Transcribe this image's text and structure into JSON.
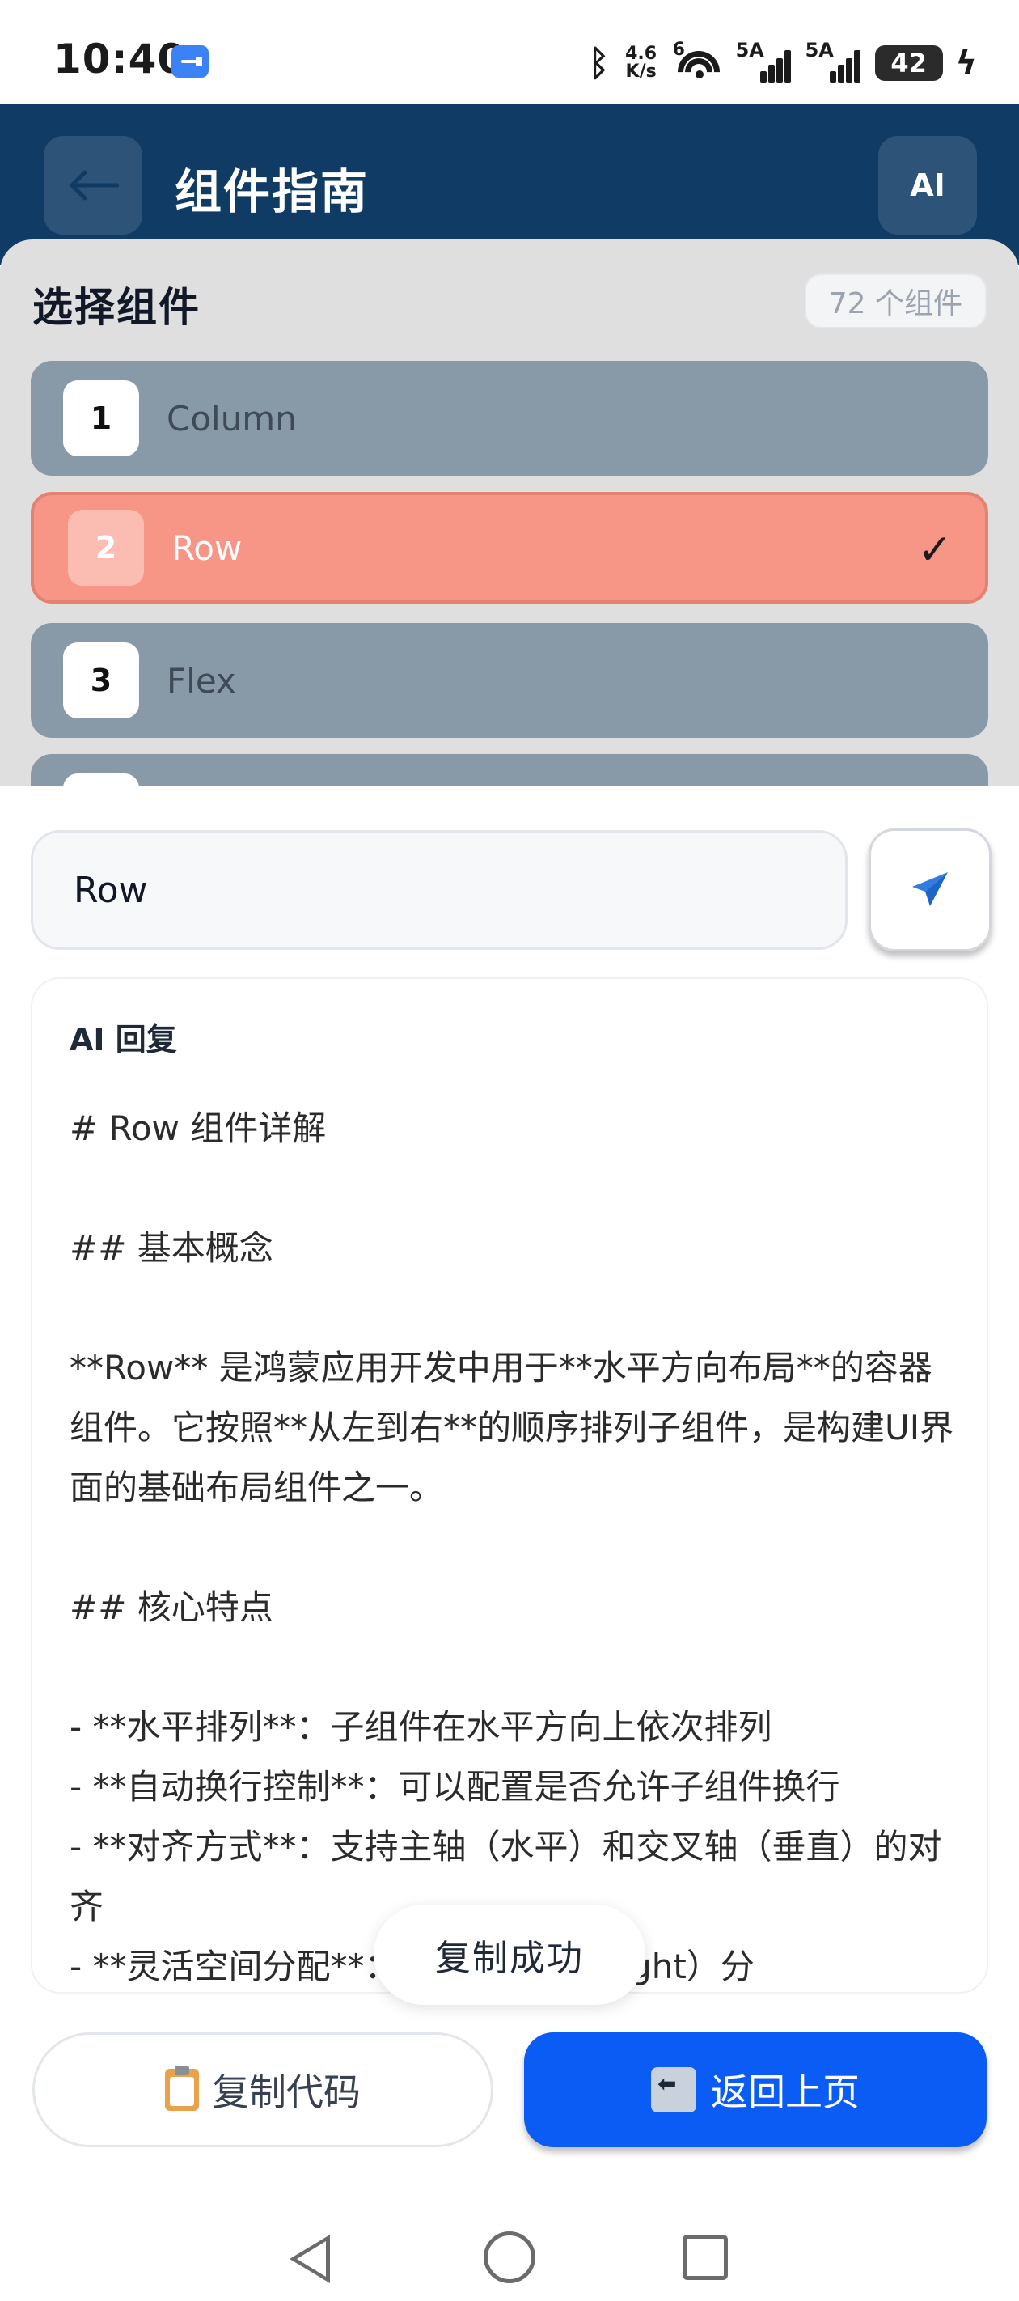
{
  "status_bar": {
    "time": "10:40",
    "network_speed": "4.6\nK/s",
    "wifi_tag": "6",
    "signal1_tag": "5A",
    "signal2_tag": "5A",
    "battery": "42"
  },
  "header": {
    "title": "组件指南",
    "ai_label": "AI"
  },
  "selector": {
    "title": "选择组件",
    "count": "72 个组件",
    "items": [
      {
        "num": "1",
        "name": "Column"
      },
      {
        "num": "2",
        "name": "Row",
        "check": "✓"
      },
      {
        "num": "3",
        "name": "Flex"
      }
    ]
  },
  "query": {
    "value": "Row"
  },
  "reply": {
    "label": "AI 回复",
    "text": "# Row 组件详解\n\n## 基本概念\n\n**Row** 是鸿蒙应用开发中用于**水平方向布局**的容器组件。它按照**从左到右**的顺序排列子组件，是构建UI界面的基础布局组件之一。\n\n## 核心特点\n\n- **水平排列**：子组件在水平方向上依次排列\n- **自动换行控制**：可以配置是否允许子组件换行\n- **对齐方式**：支持主轴（水平）和交叉轴（垂直）的对齐\n- **灵活空间分配**：支持权重（Weight）分"
  },
  "toast": {
    "text": "复制成功"
  },
  "actions": {
    "copy_label": "复制代码",
    "back_label": "返回上页"
  },
  "colors": {
    "header_bg": "#0f3b64",
    "selected_item": "#f79686",
    "item_bg": "#8899a8",
    "primary_button": "#0b5cf5"
  }
}
